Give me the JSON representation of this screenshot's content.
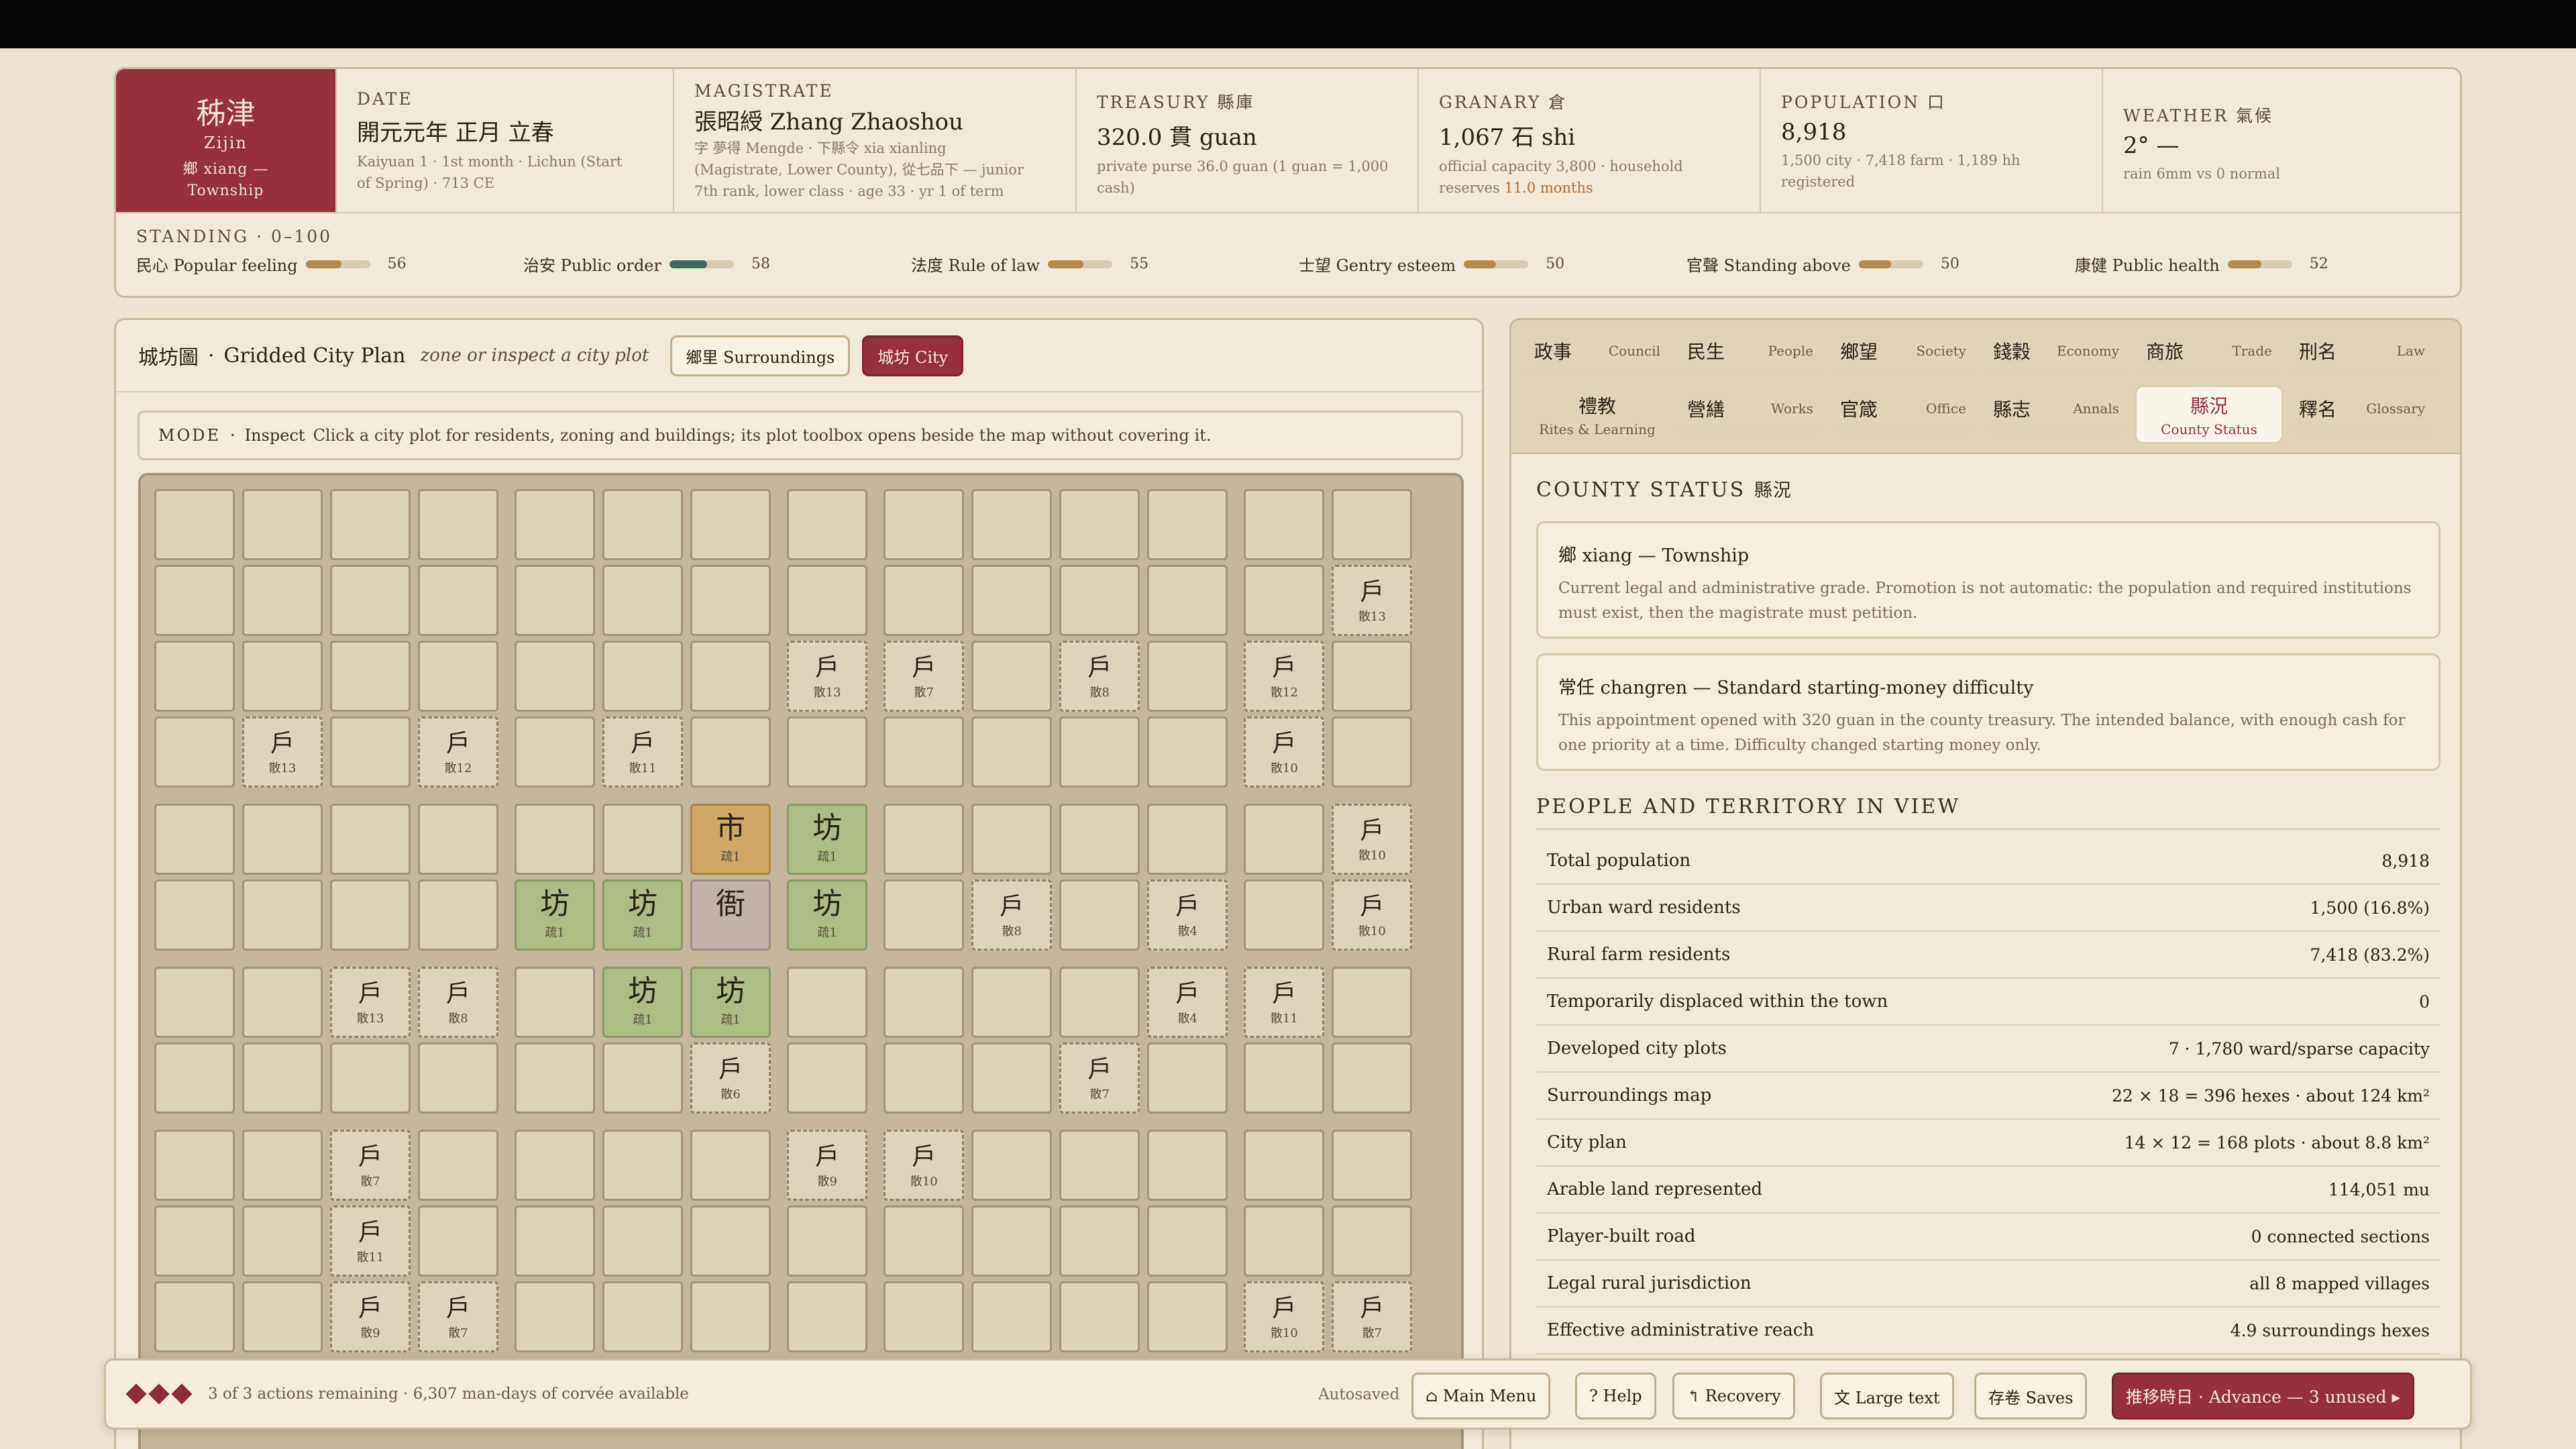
{
  "header": {
    "county": {
      "name_cn": "秭津",
      "name_py": "Zijin",
      "grade_line1": "鄉 xiang —",
      "grade_line2": "Township"
    },
    "date": {
      "label": "DATE",
      "value": "開元元年 正月 立春",
      "line1": "Kaiyuan 1  ·  1st month  ·  Lichun (Start",
      "line2": "of Spring)  ·  713 CE"
    },
    "magistrate": {
      "label": "MAGISTRATE",
      "value": "張昭綬 Zhang Zhaoshou",
      "line1": "字 夢得 Mengde  ·  下縣令 xia xianling",
      "line2": "(Magistrate, Lower County), 從七品下 — junior",
      "line3": "7th rank, lower class  ·  age 33  ·  yr 1 of term"
    },
    "treasury": {
      "label": "TREASURY 縣庫",
      "value": "320.0 貫 guan",
      "line1": "private purse 36.0 guan (1 guan = 1,000",
      "line2": "cash)"
    },
    "granary": {
      "label": "GRANARY 倉",
      "value": "1,067 石 shi",
      "line1": "official capacity 3,800  ·  household",
      "line2a": "reserves ",
      "line2b": "11.0 months"
    },
    "population": {
      "label": "POPULATION 口",
      "value": "8,918",
      "line1": "1,500 city  ·  7,418 farm  ·  1,189 hh",
      "line2": "registered"
    },
    "weather": {
      "label": "WEATHER 氣候",
      "value": "2°  —",
      "line1": "rain 6mm vs 0 normal"
    }
  },
  "standing": {
    "label": "STANDING · 0–100",
    "metrics": [
      {
        "label": "民心 Popular feeling",
        "value": 56
      },
      {
        "label": "治安 Public order",
        "value": 58
      },
      {
        "label": "法度 Rule of law",
        "value": 55
      },
      {
        "label": "士望 Gentry esteem",
        "value": 50
      },
      {
        "label": "官聲 Standing above",
        "value": 50
      },
      {
        "label": "康健 Public health",
        "value": 52
      }
    ]
  },
  "map": {
    "title_cn": "城坊圖",
    "title_sep": "·",
    "title_en": "Gridded City Plan",
    "hint": "zone or inspect a city plot",
    "btn_surroundings": "鄉里 Surroundings",
    "btn_city": "城坊 City",
    "mode_label": "MODE",
    "mode_sep": "·",
    "mode_value": "Inspect",
    "mode_desc": "Click a city plot for residents, zoning and buildings; its plot toolbox opens beside the map without covering it.",
    "rows": [
      [
        "",
        "",
        "",
        "",
        "",
        "",
        "",
        "",
        "",
        "",
        "",
        "",
        "",
        ""
      ],
      [
        "",
        "",
        "",
        "",
        "",
        "",
        "",
        "",
        "",
        "",
        "",
        "",
        "",
        "h:13"
      ],
      [
        "",
        "",
        "",
        "",
        "",
        "",
        "",
        "h:13",
        "h:7",
        "",
        "h:8",
        "",
        "h:12",
        ""
      ],
      [
        "",
        "h:13",
        "",
        "h:12",
        "",
        "h:11",
        "",
        "",
        "",
        "",
        "",
        "",
        "h:10",
        ""
      ],
      [
        "",
        "",
        "",
        "",
        "",
        "",
        "m",
        "w",
        "",
        "",
        "",
        "",
        "",
        "h:10"
      ],
      [
        "",
        "",
        "",
        "",
        "w",
        "w",
        "y",
        "w",
        "",
        "h:8",
        "",
        "h:4",
        "",
        "h:10"
      ],
      [
        "",
        "",
        "h:13",
        "h:8",
        "",
        "w",
        "w",
        "",
        "",
        "",
        "",
        "h:4",
        "h:11",
        ""
      ],
      [
        "",
        "",
        "",
        "",
        "",
        "",
        "h:6",
        "",
        "",
        "",
        "h:7",
        "",
        "",
        ""
      ],
      [
        "",
        "",
        "h:7",
        "",
        "",
        "",
        "",
        "h:9",
        "h:10",
        "",
        "",
        "",
        "",
        ""
      ],
      [
        "",
        "",
        "h:11",
        "",
        "",
        "",
        "",
        "",
        "",
        "",
        "",
        "",
        "",
        ""
      ],
      [
        "",
        "",
        "h:9",
        "h:7",
        "",
        "",
        "",
        "",
        "",
        "",
        "",
        "",
        "h:10",
        "h:7"
      ]
    ],
    "tiles": {
      "household_glyph": "戶",
      "household_prefix": "散",
      "ward_glyph": "坊",
      "ward_sub": "疏1",
      "market_glyph": "市",
      "market_sub": "疏1",
      "yamen_glyph": "衙"
    }
  },
  "tabs": [
    {
      "cn": "政事",
      "en": "Council"
    },
    {
      "cn": "民生",
      "en": "People"
    },
    {
      "cn": "鄉望",
      "en": "Society"
    },
    {
      "cn": "錢穀",
      "en": "Economy"
    },
    {
      "cn": "商旅",
      "en": "Trade"
    },
    {
      "cn": "刑名",
      "en": "Law"
    },
    {
      "cn": "禮教",
      "en": "Rites & Learning"
    },
    {
      "cn": "營繕",
      "en": "Works"
    },
    {
      "cn": "官箴",
      "en": "Office"
    },
    {
      "cn": "縣志",
      "en": "Annals"
    },
    {
      "cn": "縣況",
      "en": "County Status"
    },
    {
      "cn": "釋名",
      "en": "Glossary"
    }
  ],
  "status": {
    "title": "COUNTY STATUS",
    "title_cn": "縣況",
    "card1_title": "鄉 xiang — Township",
    "card1_desc": "Current legal and administrative grade. Promotion is not automatic: the population and required institutions must exist, then the magistrate must petition.",
    "card2_title": "常任 changren — Standard starting-money difficulty",
    "card2_desc": "This appointment opened with 320 guan in the county treasury. The intended balance, with enough cash for one priority at a time. Difficulty changed starting money only.",
    "people_title": "PEOPLE AND TERRITORY IN VIEW",
    "rows": [
      {
        "k": "Total population",
        "v": "8,918"
      },
      {
        "k": "Urban ward residents",
        "v": "1,500 (16.8%)"
      },
      {
        "k": "Rural farm residents",
        "v": "7,418 (83.2%)"
      },
      {
        "k": "Temporarily displaced within the town",
        "v": "0"
      },
      {
        "k": "Developed city plots",
        "v": "7  ·  1,780 ward/sparse capacity"
      },
      {
        "k": "Surroundings map",
        "v": "22 × 18 = 396 hexes  ·  about 124 km²"
      },
      {
        "k": "City plan",
        "v": "14 × 12 = 168 plots  ·  about 8.8 km²"
      },
      {
        "k": "Arable land represented",
        "v": "114,051 mu"
      },
      {
        "k": "Player-built road",
        "v": "0 connected sections"
      },
      {
        "k": "Legal rural jurisdiction",
        "v": "all 8 mapped villages"
      },
      {
        "k": "Effective administrative reach",
        "v": "4.9 surroundings hexes"
      }
    ]
  },
  "footer": {
    "actions": "3 of 3 actions remaining  ·  6,307 man-days of corvée available",
    "autosaved": "Autosaved",
    "main_menu": "⌂ Main Menu",
    "help": "? Help",
    "recovery": "↰ Recovery",
    "large_text": "文 Large text",
    "saves": "存卷 Saves",
    "advance": "推移時日  ·  Advance — 3 unused ▸"
  },
  "colors": {
    "accent": "#96303b",
    "ward": "#aebd86",
    "market": "#cea864",
    "yamen": "#c2b2ac",
    "tile": "#dcd4b8"
  }
}
